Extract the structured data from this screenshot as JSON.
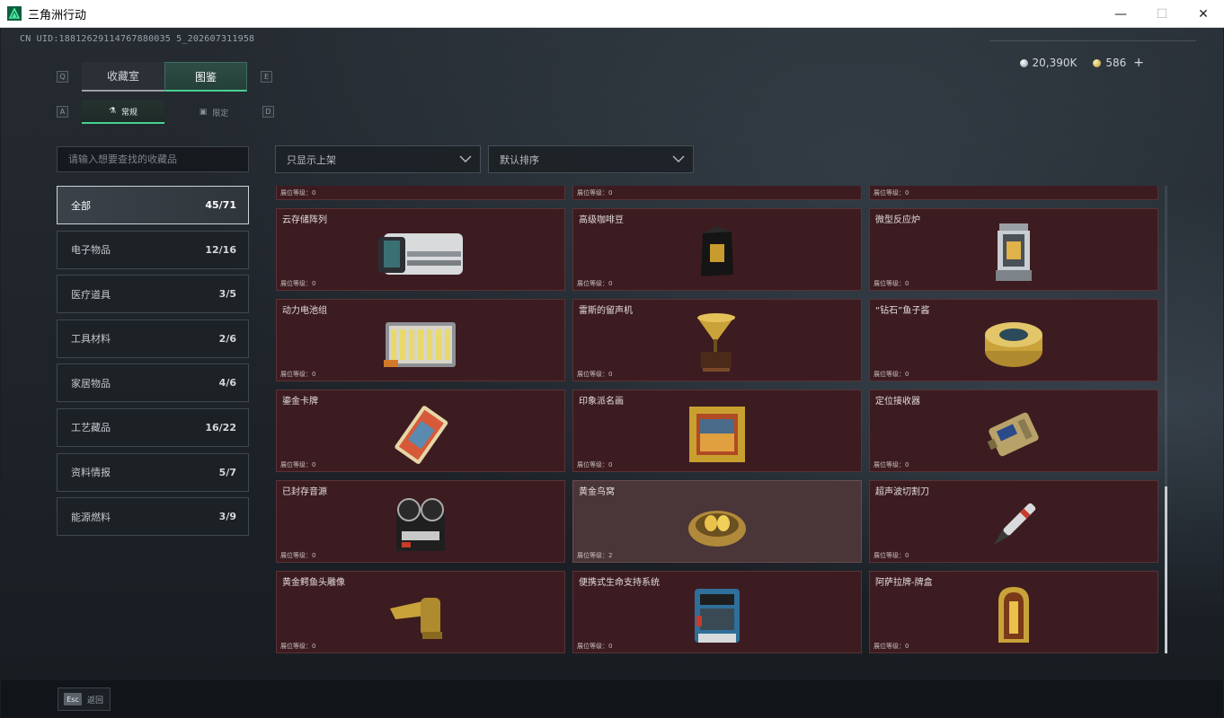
{
  "window": {
    "title": "三角洲行动",
    "minimize": "—",
    "maximize": "☐",
    "close": "✕"
  },
  "header": {
    "uid": "CN UID:18812629114767880035 5_202607311958",
    "silver_amount": "20,390K",
    "gold_amount": "586",
    "plus": "+"
  },
  "tabs": {
    "q_key": "Q",
    "e_key": "E",
    "collection": "收藏室",
    "catalog": "图鉴",
    "a_key": "A",
    "d_key": "D",
    "normal": "常规",
    "limited": "限定"
  },
  "search": {
    "placeholder": "请输入想要查找的收藏品"
  },
  "filters": {
    "show": "只显示上架",
    "sort": "默认排序"
  },
  "categories": [
    {
      "label": "全部",
      "count": "45/71"
    },
    {
      "label": "电子物品",
      "count": "12/16"
    },
    {
      "label": "医疗道具",
      "count": "3/5"
    },
    {
      "label": "工具材料",
      "count": "2/6"
    },
    {
      "label": "家居物品",
      "count": "4/6"
    },
    {
      "label": "工艺藏品",
      "count": "16/22"
    },
    {
      "label": "资料情报",
      "count": "5/7"
    },
    {
      "label": "能源燃料",
      "count": "3/9"
    }
  ],
  "items": [
    {
      "name": "",
      "level": "展位等级：0"
    },
    {
      "name": "",
      "level": "展位等级：0"
    },
    {
      "name": "",
      "level": "展位等级：0"
    },
    {
      "name": "云存储阵列",
      "level": "展位等级：0"
    },
    {
      "name": "高级咖啡豆",
      "level": "展位等级：0"
    },
    {
      "name": "微型反应炉",
      "level": "展位等级：0"
    },
    {
      "name": "动力电池组",
      "level": "展位等级：0"
    },
    {
      "name": "雷斯的留声机",
      "level": "展位等级：0"
    },
    {
      "name": "“钻石”鱼子酱",
      "level": "展位等级：0"
    },
    {
      "name": "鎏金卡牌",
      "level": "展位等级：0"
    },
    {
      "name": "印象派名画",
      "level": "展位等级：0"
    },
    {
      "name": "定位接收器",
      "level": "展位等级：0"
    },
    {
      "name": "已封存音源",
      "level": "展位等级：0"
    },
    {
      "name": "黄金鸟窝",
      "level": "展位等级：2"
    },
    {
      "name": "超声波切割刀",
      "level": "展位等级：0"
    },
    {
      "name": "黄金鳄鱼头雕像",
      "level": "展位等级：0"
    },
    {
      "name": "便携式生命支持系统",
      "level": "展位等级：0"
    },
    {
      "name": "阿萨拉牌-牌盒",
      "level": "展位等级：0"
    }
  ],
  "footer": {
    "esc_key": "Esc",
    "back": "返回"
  },
  "colors": {
    "accent": "#47d394",
    "card_bg": "#3c1c20",
    "card_highlight": "#4a3538"
  }
}
